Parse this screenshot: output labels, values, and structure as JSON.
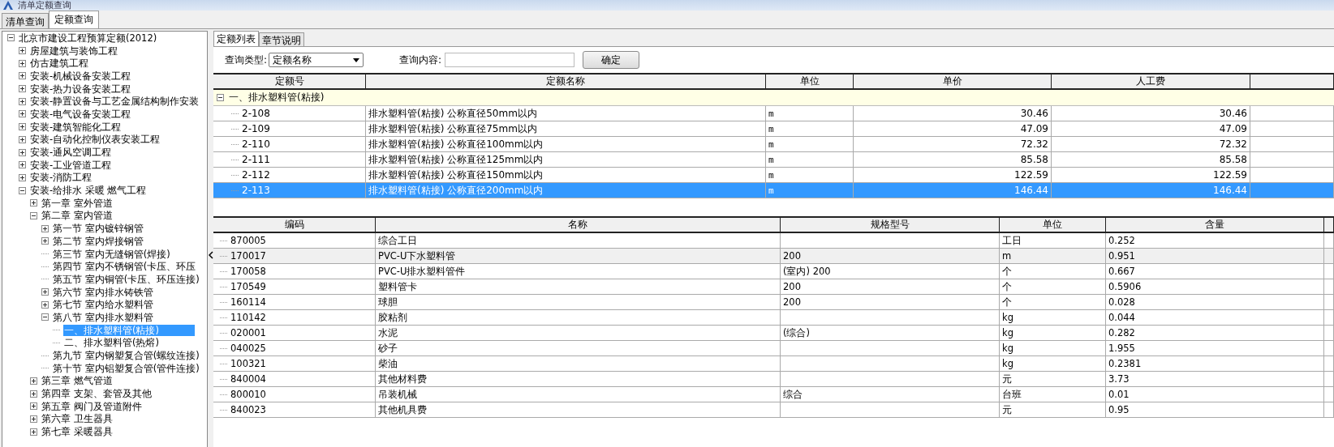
{
  "window": {
    "title": "清单定额查询"
  },
  "main_tabs": [
    {
      "label": "清单查询",
      "selected": false
    },
    {
      "label": "定额查询",
      "selected": true
    }
  ],
  "tree": [
    {
      "label": "北京市建设工程预算定额(2012)",
      "kind": "branch",
      "expanded": true,
      "selected": false,
      "children": [
        {
          "label": "房屋建筑与装饰工程",
          "kind": "branch",
          "expanded": false,
          "selected": false
        },
        {
          "label": "仿古建筑工程",
          "kind": "branch",
          "expanded": false,
          "selected": false
        },
        {
          "label": "安装-机械设备安装工程",
          "kind": "branch",
          "expanded": false,
          "selected": false
        },
        {
          "label": "安装-热力设备安装工程",
          "kind": "branch",
          "expanded": false,
          "selected": false
        },
        {
          "label": "安装-静置设备与工艺金属结构制作安装",
          "kind": "branch",
          "expanded": false,
          "selected": false
        },
        {
          "label": "安装-电气设备安装工程",
          "kind": "branch",
          "expanded": false,
          "selected": false
        },
        {
          "label": "安装-建筑智能化工程",
          "kind": "branch",
          "expanded": false,
          "selected": false
        },
        {
          "label": "安装-自动化控制仪表安装工程",
          "kind": "branch",
          "expanded": false,
          "selected": false
        },
        {
          "label": "安装-通风空调工程",
          "kind": "branch",
          "expanded": false,
          "selected": false
        },
        {
          "label": "安装-工业管道工程",
          "kind": "branch",
          "expanded": false,
          "selected": false
        },
        {
          "label": "安装-消防工程",
          "kind": "branch",
          "expanded": false,
          "selected": false
        },
        {
          "label": "安装-给排水 采暖 燃气工程",
          "kind": "branch",
          "expanded": true,
          "selected": false,
          "children": [
            {
              "label": "第一章 室外管道",
              "kind": "branch",
              "expanded": false,
              "selected": false
            },
            {
              "label": "第二章 室内管道",
              "kind": "branch",
              "expanded": true,
              "selected": false,
              "children": [
                {
                  "label": "第一节 室内镀锌钢管",
                  "kind": "branch",
                  "expanded": false,
                  "selected": false
                },
                {
                  "label": "第二节 室内焊接钢管",
                  "kind": "branch",
                  "expanded": false,
                  "selected": false
                },
                {
                  "label": "第三节 室内无缝钢管(焊接)",
                  "kind": "leaf",
                  "selected": false
                },
                {
                  "label": "第四节 室内不锈钢管(卡压、环压",
                  "kind": "leaf",
                  "selected": false
                },
                {
                  "label": "第五节 室内铜管(卡压、环压连接)",
                  "kind": "leaf",
                  "selected": false
                },
                {
                  "label": "第六节 室内排水铸铁管",
                  "kind": "branch",
                  "expanded": false,
                  "selected": false
                },
                {
                  "label": "第七节 室内给水塑料管",
                  "kind": "branch",
                  "expanded": false,
                  "selected": false
                },
                {
                  "label": "第八节 室内排水塑料管",
                  "kind": "branch",
                  "expanded": true,
                  "selected": false,
                  "children": [
                    {
                      "label": "一、排水塑料管(粘接)",
                      "kind": "leaf",
                      "selected": true
                    },
                    {
                      "label": "二、排水塑料管(热熔)",
                      "kind": "leaf",
                      "selected": false
                    }
                  ]
                },
                {
                  "label": "第九节 室内钢塑复合管(螺纹连接)",
                  "kind": "leaf",
                  "selected": false
                },
                {
                  "label": "第十节 室内铝塑复合管(管件连接)",
                  "kind": "leaf",
                  "selected": false
                }
              ]
            },
            {
              "label": "第三章 燃气管道",
              "kind": "branch",
              "expanded": false,
              "selected": false
            },
            {
              "label": "第四章 支架、套管及其他",
              "kind": "branch",
              "expanded": false,
              "selected": false
            },
            {
              "label": "第五章 阀门及管道附件",
              "kind": "branch",
              "expanded": false,
              "selected": false
            },
            {
              "label": "第六章 卫生器具",
              "kind": "branch",
              "expanded": false,
              "selected": false
            },
            {
              "label": "第七章 采暖器具",
              "kind": "branch",
              "expanded": false,
              "selected": false
            }
          ]
        }
      ]
    }
  ],
  "sub_tabs": [
    {
      "label": "定额列表",
      "selected": true
    },
    {
      "label": "章节说明",
      "selected": false
    }
  ],
  "query": {
    "type_label": "查询类型:",
    "type_value": "定额名称",
    "content_label": "查询内容:",
    "confirm": "确定"
  },
  "quota_table": {
    "columns": [
      "定额号",
      "定额名称",
      "单位",
      "单价",
      "人工费"
    ],
    "groups": [
      {
        "label": "一、排水塑料管(粘接)",
        "expanded": true,
        "rows": [
          {
            "code": "2-108",
            "name": "排水塑料管(粘接) 公称直径50mm以内",
            "unit": "m",
            "price": "30.46",
            "labor": "30.46",
            "selected": false
          },
          {
            "code": "2-109",
            "name": "排水塑料管(粘接) 公称直径75mm以内",
            "unit": "m",
            "price": "47.09",
            "labor": "47.09",
            "selected": false
          },
          {
            "code": "2-110",
            "name": "排水塑料管(粘接) 公称直径100mm以内",
            "unit": "m",
            "price": "72.32",
            "labor": "72.32",
            "selected": false
          },
          {
            "code": "2-111",
            "name": "排水塑料管(粘接) 公称直径125mm以内",
            "unit": "m",
            "price": "85.58",
            "labor": "85.58",
            "selected": false
          },
          {
            "code": "2-112",
            "name": "排水塑料管(粘接) 公称直径150mm以内",
            "unit": "m",
            "price": "122.59",
            "labor": "122.59",
            "selected": false
          },
          {
            "code": "2-113",
            "name": "排水塑料管(粘接) 公称直径200mm以内",
            "unit": "m",
            "price": "146.44",
            "labor": "146.44",
            "selected": true
          }
        ]
      }
    ]
  },
  "resource_table": {
    "columns": [
      "编码",
      "名称",
      "规格型号",
      "单位",
      "含量"
    ],
    "rows": [
      {
        "code": "870005",
        "name": "综合工日",
        "unit": "工日",
        "amount": "0.252",
        "selected": false
      },
      {
        "code": "170017",
        "name": "PVC-U下水塑料管",
        "spec": "200",
        "unit": "m",
        "amount": "0.951",
        "selected": true
      },
      {
        "code": "170058",
        "name": "PVC-U排水塑料管件",
        "spec": "(室内) 200",
        "unit": "个",
        "amount": "0.667",
        "selected": false
      },
      {
        "code": "170549",
        "name": "塑料管卡",
        "spec": "200",
        "unit": "个",
        "amount": "0.5906",
        "selected": false
      },
      {
        "code": "160114",
        "name": "球胆",
        "spec": "200",
        "unit": "个",
        "amount": "0.028",
        "selected": false
      },
      {
        "code": "110142",
        "name": "胶粘剂",
        "unit": "kg",
        "amount": "0.044",
        "selected": false
      },
      {
        "code": "020001",
        "name": "水泥",
        "spec": "(综合)",
        "unit": "kg",
        "amount": "0.282",
        "selected": false
      },
      {
        "code": "040025",
        "name": "砂子",
        "unit": "kg",
        "amount": "1.955",
        "selected": false
      },
      {
        "code": "100321",
        "name": "柴油",
        "unit": "kg",
        "amount": "0.2381",
        "selected": false
      },
      {
        "code": "840004",
        "name": "其他材料费",
        "unit": "元",
        "amount": "3.73",
        "selected": false
      },
      {
        "code": "800010",
        "name": "吊装机械",
        "spec": "综合",
        "unit": "台班",
        "amount": "0.01",
        "selected": false
      },
      {
        "code": "840023",
        "name": "其他机具费",
        "unit": "元",
        "amount": "0.95",
        "selected": false
      }
    ]
  }
}
